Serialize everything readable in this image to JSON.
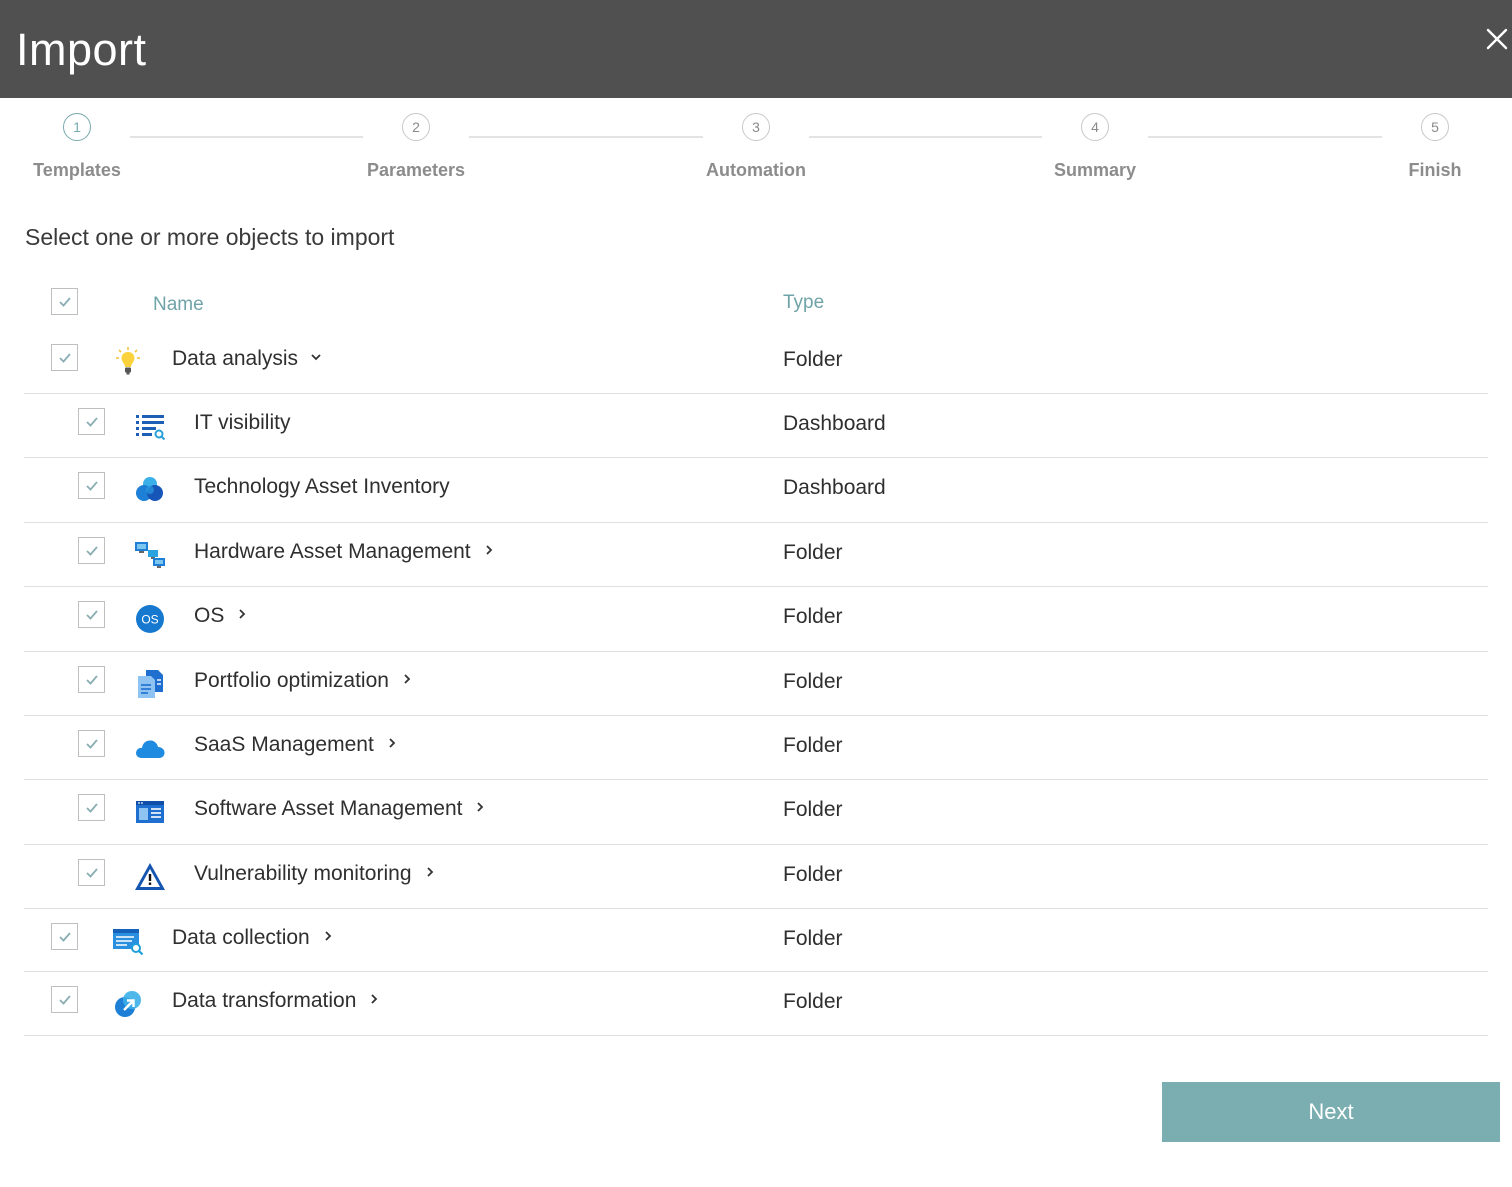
{
  "window": {
    "title": "Import"
  },
  "steps": [
    {
      "number": "1",
      "label": "Templates"
    },
    {
      "number": "2",
      "label": "Parameters"
    },
    {
      "number": "3",
      "label": "Automation"
    },
    {
      "number": "4",
      "label": "Summary"
    },
    {
      "number": "5",
      "label": "Finish"
    }
  ],
  "active_step": 1,
  "instruction": "Select one or more objects to import",
  "table": {
    "columns": {
      "name": "Name",
      "type": "Type"
    },
    "rows": [
      {
        "name": "Data analysis",
        "type": "Folder",
        "level": 0,
        "icon": "lightbulb-icon",
        "expander": "chevron-down-icon",
        "checked": true
      },
      {
        "name": "IT visibility",
        "type": "Dashboard",
        "level": 1,
        "icon": "list-search-icon",
        "expander": "",
        "checked": true
      },
      {
        "name": "Technology Asset Inventory",
        "type": "Dashboard",
        "level": 1,
        "icon": "bubbles-icon",
        "expander": "",
        "checked": true
      },
      {
        "name": "Hardware Asset Management",
        "type": "Folder",
        "level": 1,
        "icon": "computers-icon",
        "expander": "chevron-right-icon",
        "checked": true
      },
      {
        "name": "OS",
        "type": "Folder",
        "level": 1,
        "icon": "os-icon",
        "icon_text": "OS",
        "expander": "chevron-right-icon",
        "checked": true
      },
      {
        "name": "Portfolio optimization",
        "type": "Folder",
        "level": 1,
        "icon": "documents-icon",
        "expander": "chevron-right-icon",
        "checked": true
      },
      {
        "name": "SaaS Management",
        "type": "Folder",
        "level": 1,
        "icon": "cloud-icon",
        "expander": "chevron-right-icon",
        "checked": true
      },
      {
        "name": "Software Asset Management",
        "type": "Folder",
        "level": 1,
        "icon": "software-window-icon",
        "expander": "chevron-right-icon",
        "checked": true
      },
      {
        "name": "Vulnerability monitoring",
        "type": "Folder",
        "level": 1,
        "icon": "warning-triangle-icon",
        "expander": "chevron-right-icon",
        "checked": true
      },
      {
        "name": "Data collection",
        "type": "Folder",
        "level": 0,
        "icon": "data-collection-icon",
        "expander": "chevron-right-icon",
        "checked": true
      },
      {
        "name": "Data transformation",
        "type": "Folder",
        "level": 0,
        "icon": "transform-icon",
        "expander": "chevron-right-icon",
        "checked": true
      }
    ]
  },
  "footer": {
    "next_label": "Next"
  },
  "colors": {
    "accent": "#7aaeb0",
    "header_bg": "#505050",
    "column_head": "#6fa3a8"
  }
}
